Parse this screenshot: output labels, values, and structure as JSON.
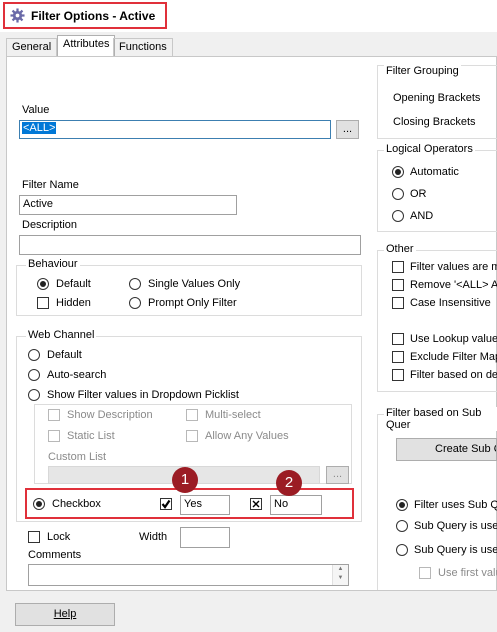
{
  "window": {
    "title": "Filter Options - Active"
  },
  "tabs": [
    "General",
    "Attributes",
    "Functions"
  ],
  "value": {
    "label": "Value",
    "text": "<ALL>",
    "browse": "..."
  },
  "filter_name": {
    "label": "Filter Name",
    "value": "Active"
  },
  "description": {
    "label": "Description",
    "value": ""
  },
  "behaviour": {
    "label": "Behaviour",
    "default": "Default",
    "hidden": "Hidden",
    "single_values_only": "Single Values Only",
    "prompt_only_filter": "Prompt Only Filter"
  },
  "web_channel": {
    "label": "Web Channel",
    "default": "Default",
    "auto_search": "Auto-search",
    "show_in_dropdown": "Show Filter values in Dropdown Picklist",
    "show_description": "Show Description",
    "multi_select": "Multi-select",
    "static_list": "Static List",
    "allow_any_values": "Allow Any Values",
    "custom_list": "Custom List",
    "custom_list_browse": "...",
    "checkbox": "Checkbox",
    "yes_value": "Yes",
    "no_value": "No",
    "badge1": "1",
    "badge2": "2"
  },
  "lock": "Lock",
  "width": {
    "label": "Width",
    "value": ""
  },
  "comments": {
    "label": "Comments",
    "value": ""
  },
  "filter_grouping": {
    "label": "Filter Grouping",
    "opening": "Opening Brackets",
    "closing": "Closing Brackets"
  },
  "logical_operators": {
    "label": "Logical Operators",
    "automatic": "Automatic",
    "or": "OR",
    "and": "AND"
  },
  "other": {
    "label": "Other",
    "items": [
      "Filter values are ma",
      "Remove '<ALL> Al",
      "Case Insensitive",
      "Use Lookup value",
      "Exclude Filter Map",
      "Filter based on des"
    ]
  },
  "sub_query": {
    "label": "Filter based on Sub Quer",
    "create_button": "Create Sub Q",
    "uses": "Filter uses Sub Qu",
    "used1": "Sub Query is used",
    "used2": "Sub Query is used",
    "use_first": "Use first valu"
  },
  "help_button": "Help"
}
